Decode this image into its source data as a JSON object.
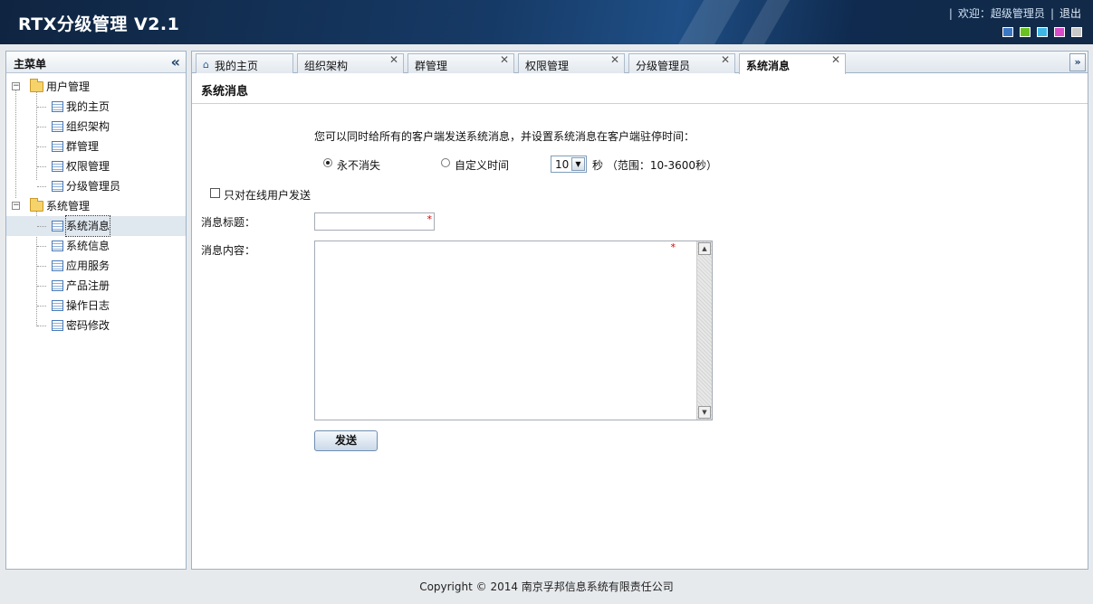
{
  "header": {
    "title": "RTX分级管理  V2.1",
    "welcome": "欢迎：超级管理员",
    "logout": "退出",
    "theme_colors": [
      "#3b78c4",
      "#69c21f",
      "#3fb7e6",
      "#d94bc8",
      "#c9c9c9"
    ]
  },
  "sidebar": {
    "title": "主菜单",
    "groups": [
      {
        "label": "用户管理",
        "items": [
          "我的主页",
          "组织架构",
          "群管理",
          "权限管理",
          "分级管理员"
        ]
      },
      {
        "label": "系统管理",
        "items": [
          "系统消息",
          "系统信息",
          "应用服务",
          "产品注册",
          "操作日志",
          "密码修改"
        ]
      }
    ],
    "selected": "系统消息"
  },
  "tabs": [
    {
      "label": "我的主页",
      "closable": false,
      "icon": "home-icon"
    },
    {
      "label": "组织架构",
      "closable": true
    },
    {
      "label": "群管理",
      "closable": true
    },
    {
      "label": "权限管理",
      "closable": true
    },
    {
      "label": "分级管理员",
      "closable": true
    },
    {
      "label": "系统消息",
      "closable": true,
      "active": true
    }
  ],
  "form": {
    "page_title": "系统消息",
    "intro": "您可以同时给所有的客户端发送系统消息，并设置系统消息在客户端驻停时间：",
    "radio_forever": "永不消失",
    "radio_custom": "自定义时间",
    "duration_value": "10",
    "seconds_unit": "秒",
    "range_text": "（范围：10-3600秒）",
    "online_only": "只对在线用户发送",
    "subject_label": "消息标题：",
    "content_label": "消息内容：",
    "required_mark": "*",
    "send_label": "发送"
  },
  "footer": {
    "copyright": "Copyright © 2014 南京孚邦信息系统有限责任公司"
  }
}
